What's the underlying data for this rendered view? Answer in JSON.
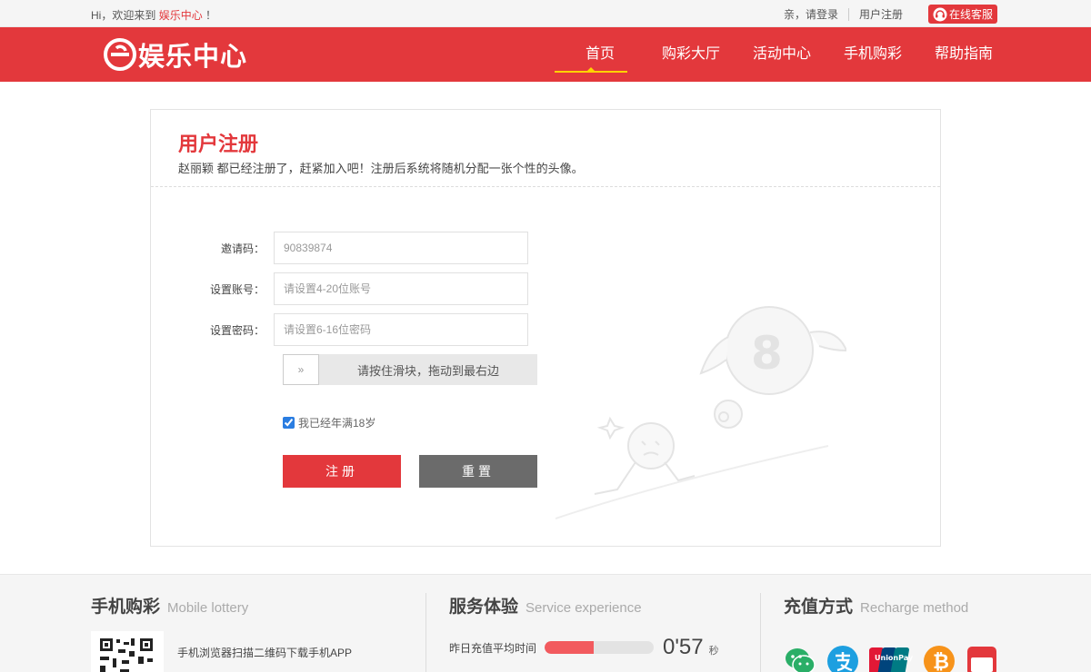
{
  "topbar": {
    "welcome_prefix": "Hi，欢迎来到",
    "welcome_brand": "娱乐中心",
    "welcome_suffix": "！",
    "login": "亲，请登录",
    "register": "用户注册",
    "service": "在线客服"
  },
  "header": {
    "logo_text": "娱乐中心",
    "nav": [
      "首页",
      "购彩大厅",
      "活动中心",
      "手机购彩",
      "帮助指南"
    ],
    "active_nav": "首页"
  },
  "register": {
    "title": "用户注册",
    "subtitle": "赵丽颖 都已经注册了，赶紧加入吧！注册后系统将随机分配一张个性的头像。",
    "invite_label": "邀请码：",
    "invite_value": "90839874",
    "account_label": "设置账号：",
    "account_placeholder": "请设置4-20位账号",
    "password_label": "设置密码：",
    "password_placeholder": "请设置6-16位密码",
    "slider_handle": "»",
    "slider_hint": "请按住滑块，拖动到最右边",
    "agree_label": "我已经年满18岁",
    "agree_checked": true,
    "submit": "注册",
    "reset": "重置"
  },
  "footer": {
    "mobile_title": "手机购彩",
    "mobile_sub": "Mobile lottery",
    "qr_text": "手机浏览器扫描二维码下载手机APP",
    "service_title": "服务体验",
    "service_sub": "Service experience",
    "stat_label": "昨日充值平均时间",
    "stat_value": "0'57",
    "stat_unit": "秒",
    "stat_fill_percent": 45,
    "recharge_title": "充值方式",
    "recharge_sub": "Recharge method",
    "pay_methods": [
      "wechat-pay-icon",
      "alipay-icon",
      "unionpay-icon",
      "bitcoin-icon",
      "quickpass-icon"
    ],
    "colors": {
      "brand_red": "#e3383c",
      "nav_underline": "#ffd200"
    }
  }
}
